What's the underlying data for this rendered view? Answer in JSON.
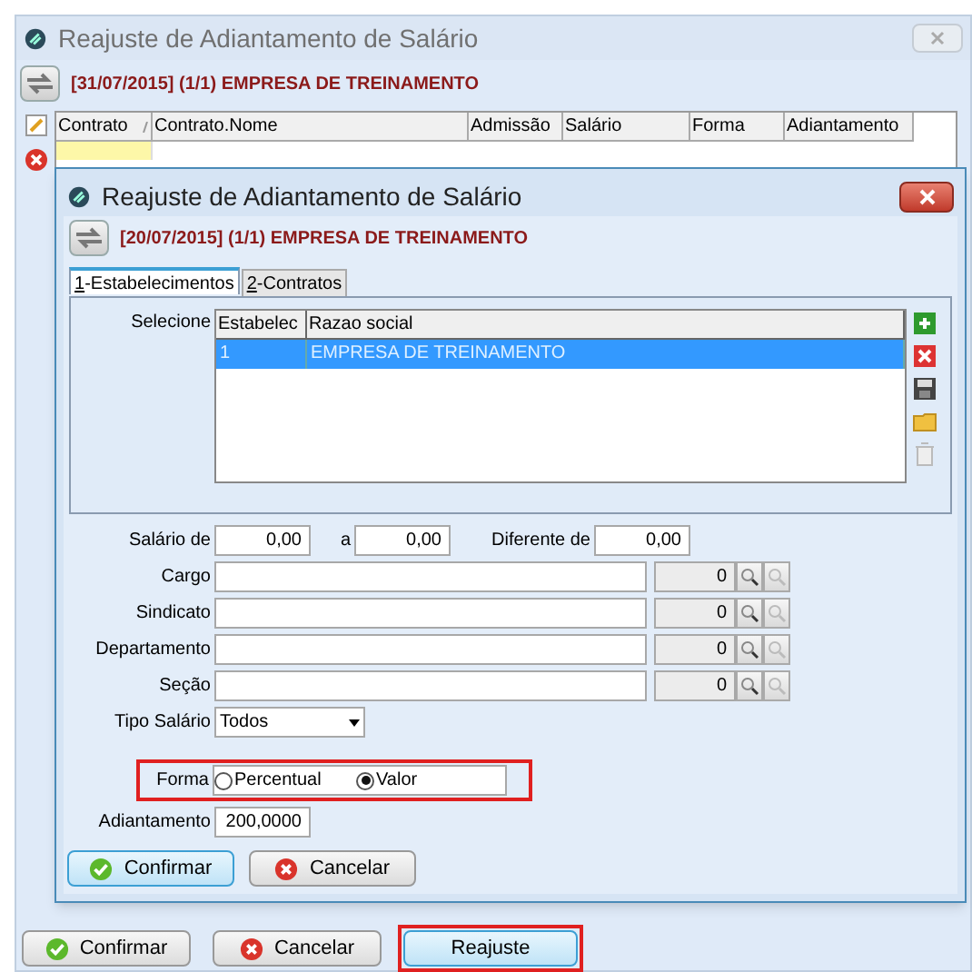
{
  "window": {
    "title": "Reajuste de Adiantamento de Salário",
    "header": "[31/07/2015] (1/1) EMPRESA DE TREINAMENTO"
  },
  "grid": {
    "columns": [
      {
        "label": "Contrato",
        "sorted": true
      },
      {
        "label": "Contrato.Nome",
        "sorted": false
      },
      {
        "label": "Admissão",
        "sorted": false
      },
      {
        "label": "Salário",
        "sorted": false
      },
      {
        "label": "Forma",
        "sorted": false
      },
      {
        "label": "Adiantamento",
        "sorted": false
      }
    ]
  },
  "dialog": {
    "title": "Reajuste de Adiantamento de Salário",
    "header": "[20/07/2015] (1/1) EMPRESA DE TREINAMENTO",
    "tabs": [
      {
        "label": "1-Estabelecimentos",
        "selected": true
      },
      {
        "label": "2-Contratos",
        "selected": false
      }
    ],
    "select_label": "Selecione",
    "establishments": {
      "columns": [
        "Estabelec",
        "Razao social"
      ],
      "rows": [
        {
          "cells": [
            "1",
            "EMPRESA DE TREINAMENTO"
          ],
          "selected": true
        }
      ]
    },
    "salary": {
      "from_label": "Salário de",
      "from": "0,00",
      "to_label": "a",
      "to": "0,00",
      "diff_label": "Diferente de",
      "diff": "0,00"
    },
    "lookups": [
      {
        "label": "Cargo",
        "code": "0"
      },
      {
        "label": "Sindicato",
        "code": "0"
      },
      {
        "label": "Departamento",
        "code": "0"
      },
      {
        "label": "Seção",
        "code": "0"
      }
    ],
    "salary_type": {
      "label": "Tipo Salário",
      "value": "Todos"
    },
    "forma": {
      "label": "Forma",
      "highlighted": true,
      "options": [
        {
          "label": "Percentual",
          "selected": false
        },
        {
          "label": "Valor",
          "selected": true
        }
      ]
    },
    "advance": {
      "label": "Adiantamento",
      "value": "200,0000"
    },
    "buttons": [
      {
        "label": "Confirmar",
        "kind": "confirm",
        "focused": true
      },
      {
        "label": "Cancelar",
        "kind": "cancel",
        "focused": false
      }
    ]
  },
  "buttons": [
    {
      "label": "Confirmar",
      "kind": "confirm",
      "highlighted": false
    },
    {
      "label": "Cancelar",
      "kind": "cancel",
      "highlighted": false
    },
    {
      "label": "Reajuste",
      "kind": "plain",
      "highlighted": true
    }
  ]
}
